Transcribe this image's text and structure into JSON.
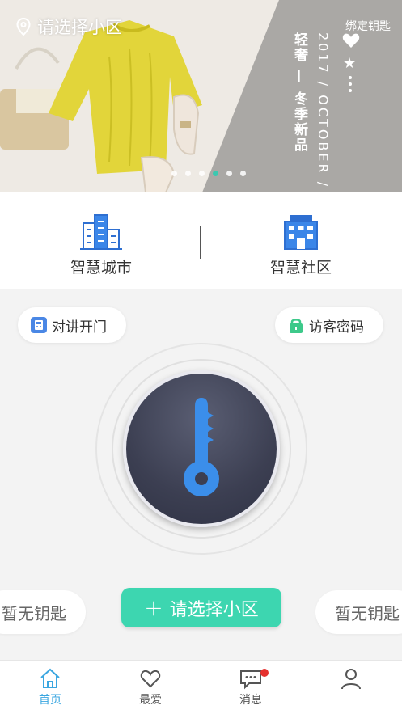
{
  "banner": {
    "location_label": "请选择小区",
    "bind_key_label": "绑定钥匙",
    "vertical_date": "2017 / OCTOBER /",
    "vertical_tagline": "轻奢 — 冬季新品",
    "slide_count": 6,
    "active_slide": 4
  },
  "smart": {
    "city_label": "智慧城市",
    "community_label": "智慧社区"
  },
  "main": {
    "intercom_label": "对讲开门",
    "visitor_label": "访客密码",
    "no_key_left": "暂无钥匙",
    "no_key_right": "暂无钥匙",
    "select_button_plus": "+",
    "select_button_label": "请选择小区"
  },
  "tabbar": {
    "home": "首页",
    "favorites": "最爱",
    "messages": "消息",
    "me": ""
  },
  "colors": {
    "accent": "#3dd6b0",
    "active_tab": "#3aa6e0",
    "badge": "#e5302e",
    "key_blue": "#3b8eea"
  }
}
